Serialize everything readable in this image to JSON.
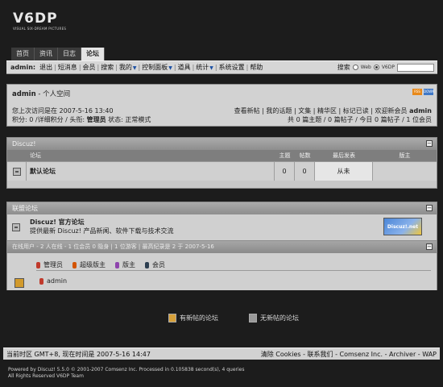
{
  "brand": {
    "logo": "V6DP",
    "tagline": "VISUAL SIX-DREAM PICTURES"
  },
  "tabs": [
    {
      "label": "首页"
    },
    {
      "label": "资讯"
    },
    {
      "label": "日志"
    },
    {
      "label": "论坛"
    }
  ],
  "navbar": {
    "user": "admin:",
    "items": [
      "退出",
      "短消息",
      "会员",
      "搜索",
      "我的",
      "控制面板",
      "道具",
      "统计",
      "系统设置",
      "帮助"
    ],
    "search_label": "搜索",
    "radio_web": "Web",
    "radio_site": "V6DP"
  },
  "personal": {
    "title_user": "admin",
    "title_rest": " - 个人空间",
    "badge_rss": "RSS",
    "badge_jump": "DOWN",
    "last_visit_label": "您上次访问是在",
    "last_visit": "2007-5-16 13:40",
    "line2": "积分: 0 /详细积分 / 头衔: ",
    "title_name": "管理员",
    "status": " 状态: 正常模式",
    "links": "查看新帖 | 我的话题 | 文集 | 精华区 | 标记已读 | 欢迎新会员 ",
    "new_member": "admin",
    "stats": "共 0 篇主题 / 0 篇帖子 / 今日 0 篇帖子 / 1 位会员"
  },
  "forums": {
    "header": "Discuz!",
    "col_forum": "论坛",
    "col_topics": "主题",
    "col_posts": "帖数",
    "col_last": "最后发表",
    "col_mod": "版主",
    "rows": [
      {
        "name": "默认论坛",
        "topics": "0",
        "posts": "0",
        "last": "从未",
        "mod": ""
      }
    ]
  },
  "new_forum": {
    "header": "联盟论坛",
    "title": "Discuz! 官方论坛",
    "desc": "提供最新 Discuz! 产品新闻、软件下载与技术交流",
    "logo_text": "Discuz!.net"
  },
  "online": {
    "header": "在线用户 - 2 人在线 - 1 位会员 0 隐身 | 1 位游客 | 最高纪录是 2 于 2007-5-16",
    "legend": [
      {
        "label": "管理员",
        "color": "#c0392b"
      },
      {
        "label": "超级版主",
        "color": "#d35400"
      },
      {
        "label": "版主",
        "color": "#8e44ad"
      },
      {
        "label": "会员",
        "color": "#2c3e50"
      }
    ],
    "user": "admin"
  },
  "status_legend": {
    "new_posts": "有新帖的论坛",
    "no_new": "无新帖的论坛"
  },
  "footer": {
    "time": "当前时区 GMT+8, 现在时间是 2007-5-16 14:47",
    "links": "清除 Cookies - 联系我们 - Comsenz Inc. - Archiver - WAP",
    "copy1": "Powered by Discuz! 5.5.0  © 2001-2007 Comsenz Inc.  Processed in 0.105838 second(s), 4 queries",
    "copy2": "All Rights Reserved V6DP Team"
  }
}
